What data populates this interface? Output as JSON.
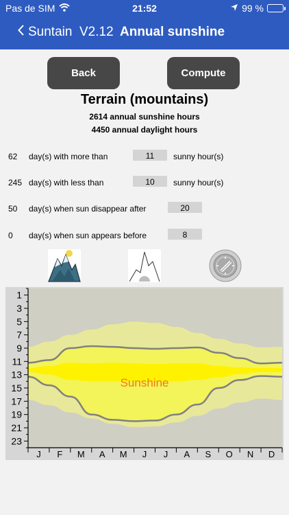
{
  "status_bar": {
    "carrier": "Pas de SIM",
    "time": "21:52",
    "battery": "99 %",
    "battery_level": 0.99,
    "icons": [
      "wifi-icon",
      "location-arrow-icon",
      "battery-charging-icon"
    ]
  },
  "nav": {
    "back_label": "Suntain  V2.12",
    "title": "Annual sunshine"
  },
  "buttons": {
    "back": "Back",
    "compute": "Compute"
  },
  "summary": {
    "title": "Terrain (mountains)",
    "sunshine_hours": "2614 annual sunshine hours",
    "daylight_hours": "4450 annual daylight hours"
  },
  "rows": [
    {
      "count": "62",
      "label": "day(s) with more than",
      "value": "11",
      "unit": "sunny hour(s)"
    },
    {
      "count": "245",
      "label": "day(s) with less than",
      "value": "10",
      "unit": "sunny hour(s)"
    },
    {
      "count": "50",
      "label": "day(s) when sun disappear after",
      "value": "20",
      "unit": ""
    },
    {
      "count": "0",
      "label": "day(s) when sun appears before",
      "value": "8",
      "unit": ""
    }
  ],
  "mode_icons": [
    "mountain-terrain-icon",
    "mountain-outline-icon",
    "compass-icon"
  ],
  "colors": {
    "nav_bar": "#2e5bc0",
    "button": "#474747",
    "sunshine_band": "#f3f35a",
    "daylight_band": "#e8e89a",
    "sun_core": "#fff200",
    "chart_bg": "#cfcfc4",
    "line": "#808080",
    "sunshine_label": "#f07c00"
  },
  "chart_data": {
    "type": "area",
    "title": "",
    "annotation": "Sunshine",
    "x_ticks": [
      "J",
      "F",
      "M",
      "A",
      "M",
      "J",
      "J",
      "A",
      "S",
      "O",
      "N",
      "D"
    ],
    "y_ticks": [
      "1",
      "3",
      "5",
      "7",
      "9",
      "11",
      "13",
      "15",
      "17",
      "19",
      "21",
      "23"
    ],
    "ylim": [
      0,
      24
    ],
    "y_inverted": true,
    "x_months": [
      0,
      1,
      2,
      3,
      4,
      5,
      6,
      7,
      8,
      9,
      10,
      11,
      12
    ],
    "series": [
      {
        "name": "",
        "values": [
          11.2,
          10.8,
          9.0,
          8.7,
          8.8,
          9.0,
          9.1,
          9.0,
          8.9,
          9.7,
          10.5,
          11.3,
          11.2
        ]
      },
      {
        "name": "",
        "values": [
          13.3,
          14.6,
          16.3,
          19.0,
          19.8,
          20.0,
          19.9,
          19.0,
          17.5,
          15.0,
          13.8,
          13.2,
          13.3
        ]
      }
    ],
    "daylight_bounds": {
      "sunrise": [
        8.8,
        8.0,
        7.0,
        6.2,
        5.4,
        5.0,
        5.2,
        5.8,
        6.7,
        7.6,
        8.3,
        8.9,
        8.8
      ],
      "sunset": [
        16.8,
        17.6,
        18.7,
        19.6,
        20.4,
        20.9,
        20.8,
        20.2,
        19.2,
        18.1,
        17.2,
        16.6,
        16.8
      ]
    },
    "sun_core_bounds": {
      "top": [
        12.0,
        11.7,
        11.2,
        11.3,
        11.2,
        11.3,
        11.4,
        11.3,
        11.3,
        11.7,
        11.9,
        12.0,
        12.0
      ],
      "bottom": [
        12.6,
        13.0,
        13.8,
        14.0,
        14.0,
        14.0,
        14.0,
        14.0,
        13.8,
        13.4,
        12.9,
        12.6,
        12.6
      ]
    }
  }
}
